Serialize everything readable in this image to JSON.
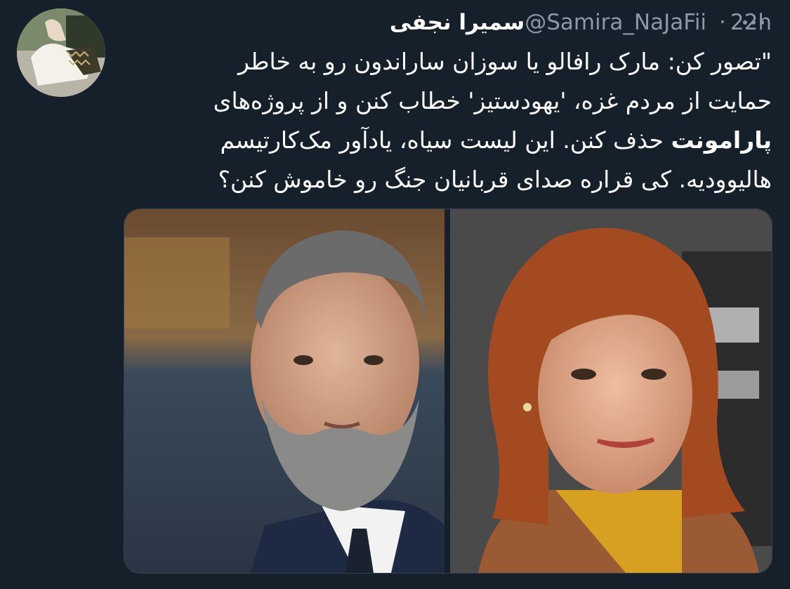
{
  "author": {
    "display_name": "سمیرا نجفی",
    "handle": "@Samira_NaJaFii",
    "separator": "·",
    "time": "22h",
    "avatar_icon": "profile-photo"
  },
  "more_icon": "more-horizontal-icon",
  "tweet": {
    "line1": "\"تصور کن: مارک رافالو یا سوزان ساراندون رو به خاطر",
    "line2": "حمایت از مردم غزه، 'یهودستیز' خطاب کنن و از پروژه‌های",
    "line3_bold": "پارامونت",
    "line3_rest": " حذف کنن. این لیست سیاه، یادآور مک‌کارتیسم",
    "line4": "هالیوودیه. کی قراره صدای قربانیان جنگ رو خاموش کنن؟"
  },
  "media": {
    "left_photo": "man-with-gray-beard-photo",
    "right_photo": "woman-with-red-hair-photo"
  },
  "colors": {
    "background": "#15202b",
    "text": "#ffffff",
    "secondary_text": "#8b98a5"
  }
}
